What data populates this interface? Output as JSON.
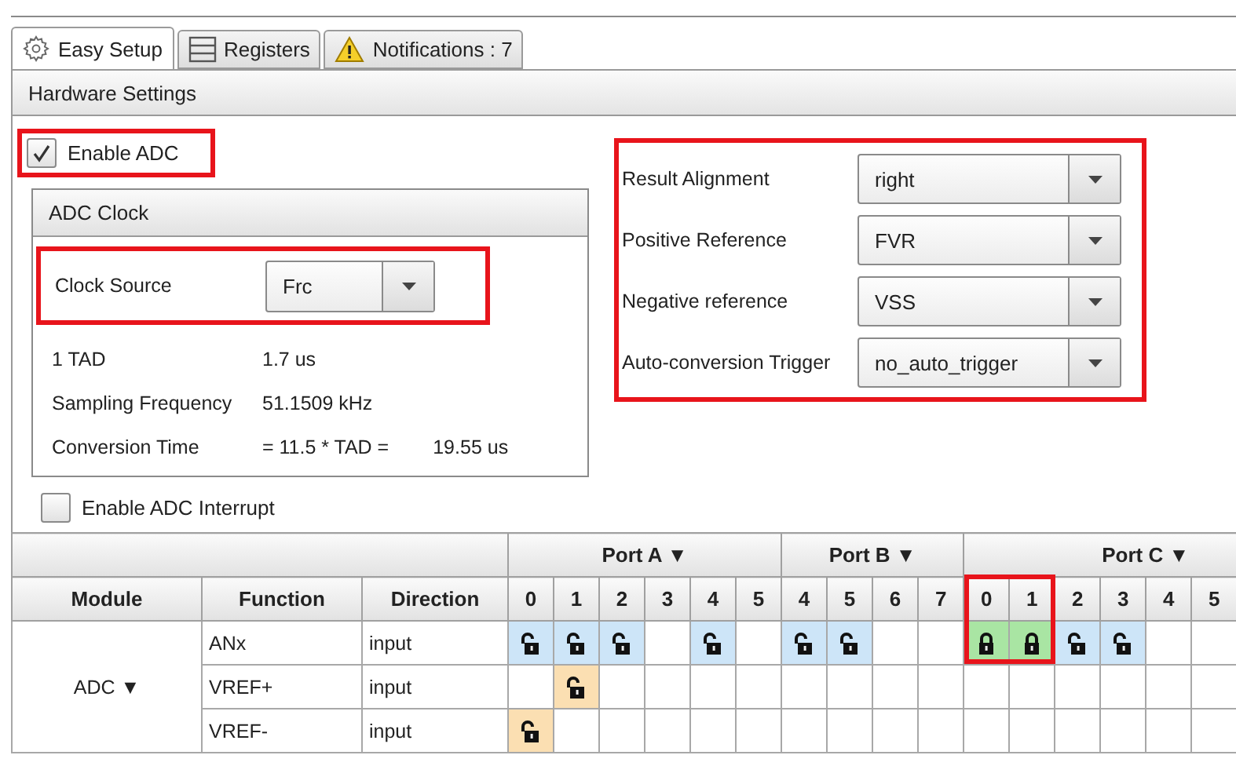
{
  "tabs": [
    {
      "label": "Easy Setup",
      "kind": "gear",
      "selected": true
    },
    {
      "label": "Registers",
      "kind": "registers",
      "selected": false
    },
    {
      "label": "Notifications : 7",
      "kind": "warning",
      "selected": false
    }
  ],
  "section_title": "Hardware Settings",
  "enable_adc": {
    "label": "Enable ADC",
    "checked": true,
    "highlighted": true
  },
  "adc_clock": {
    "title": "ADC Clock",
    "clock_source": {
      "label": "Clock Source",
      "value": "Frc",
      "highlighted": true
    },
    "info": [
      {
        "label": "1 TAD",
        "value": "1.7 us"
      },
      {
        "label": "Sampling Frequency",
        "value": "51.1509 kHz"
      },
      {
        "label": "Conversion Time",
        "value": "= 11.5 * TAD =",
        "extra": "19.55 us"
      }
    ]
  },
  "enable_interrupt": {
    "label": "Enable ADC Interrupt",
    "checked": false
  },
  "settings": {
    "highlighted": true,
    "fields": [
      {
        "label": "Result Alignment",
        "value": "right"
      },
      {
        "label": "Positive Reference",
        "value": "FVR"
      },
      {
        "label": "Negative reference",
        "value": "VSS"
      },
      {
        "label": "Auto-conversion Trigger",
        "value": "no_auto_trigger"
      }
    ]
  },
  "pin_table": {
    "columns": [
      "Module",
      "Function",
      "Direction"
    ],
    "ports": [
      {
        "name": "Port A ▼",
        "pins": [
          {
            "label": "0",
            "highlighted": false
          },
          {
            "label": "1",
            "highlighted": false
          },
          {
            "label": "2",
            "highlighted": false
          },
          {
            "label": "3",
            "highlighted": false
          },
          {
            "label": "4",
            "highlighted": false
          },
          {
            "label": "5",
            "highlighted": false
          }
        ]
      },
      {
        "name": "Port B ▼",
        "pins": [
          {
            "label": "4",
            "highlighted": false
          },
          {
            "label": "5",
            "highlighted": false
          },
          {
            "label": "6",
            "highlighted": false
          },
          {
            "label": "7",
            "highlighted": false
          }
        ]
      },
      {
        "name": "Port C ▼",
        "pins": [
          {
            "label": "0",
            "highlighted": true
          },
          {
            "label": "1",
            "highlighted": true
          },
          {
            "label": "2",
            "highlighted": false
          },
          {
            "label": "3",
            "highlighted": false
          },
          {
            "label": "4",
            "highlighted": false
          },
          {
            "label": "5",
            "highlighted": false
          }
        ]
      }
    ],
    "modules": [
      {
        "name": "ADC ▼",
        "rows": [
          {
            "function": "ANx",
            "direction": "input",
            "pins": [
              {
                "kind": "available"
              },
              {
                "kind": "available"
              },
              {
                "kind": "available"
              },
              {
                "kind": "none"
              },
              {
                "kind": "available"
              },
              {
                "kind": "none"
              },
              {
                "kind": "available"
              },
              {
                "kind": "available"
              },
              {
                "kind": "none"
              },
              {
                "kind": "none"
              },
              {
                "kind": "locked"
              },
              {
                "kind": "locked"
              },
              {
                "kind": "available"
              },
              {
                "kind": "available"
              },
              {
                "kind": "none"
              },
              {
                "kind": "none"
              }
            ]
          },
          {
            "function": "VREF+",
            "direction": "input",
            "pins": [
              {
                "kind": "none"
              },
              {
                "kind": "option"
              },
              {
                "kind": "none"
              },
              {
                "kind": "none"
              },
              {
                "kind": "none"
              },
              {
                "kind": "none"
              },
              {
                "kind": "none"
              },
              {
                "kind": "none"
              },
              {
                "kind": "none"
              },
              {
                "kind": "none"
              },
              {
                "kind": "none"
              },
              {
                "kind": "none"
              },
              {
                "kind": "none"
              },
              {
                "kind": "none"
              },
              {
                "kind": "none"
              },
              {
                "kind": "none"
              }
            ]
          },
          {
            "function": "VREF-",
            "direction": "input",
            "pins": [
              {
                "kind": "option"
              },
              {
                "kind": "none"
              },
              {
                "kind": "none"
              },
              {
                "kind": "none"
              },
              {
                "kind": "none"
              },
              {
                "kind": "none"
              },
              {
                "kind": "none"
              },
              {
                "kind": "none"
              },
              {
                "kind": "none"
              },
              {
                "kind": "none"
              },
              {
                "kind": "none"
              },
              {
                "kind": "none"
              },
              {
                "kind": "none"
              },
              {
                "kind": "none"
              },
              {
                "kind": "none"
              },
              {
                "kind": "none"
              }
            ]
          }
        ]
      }
    ]
  }
}
